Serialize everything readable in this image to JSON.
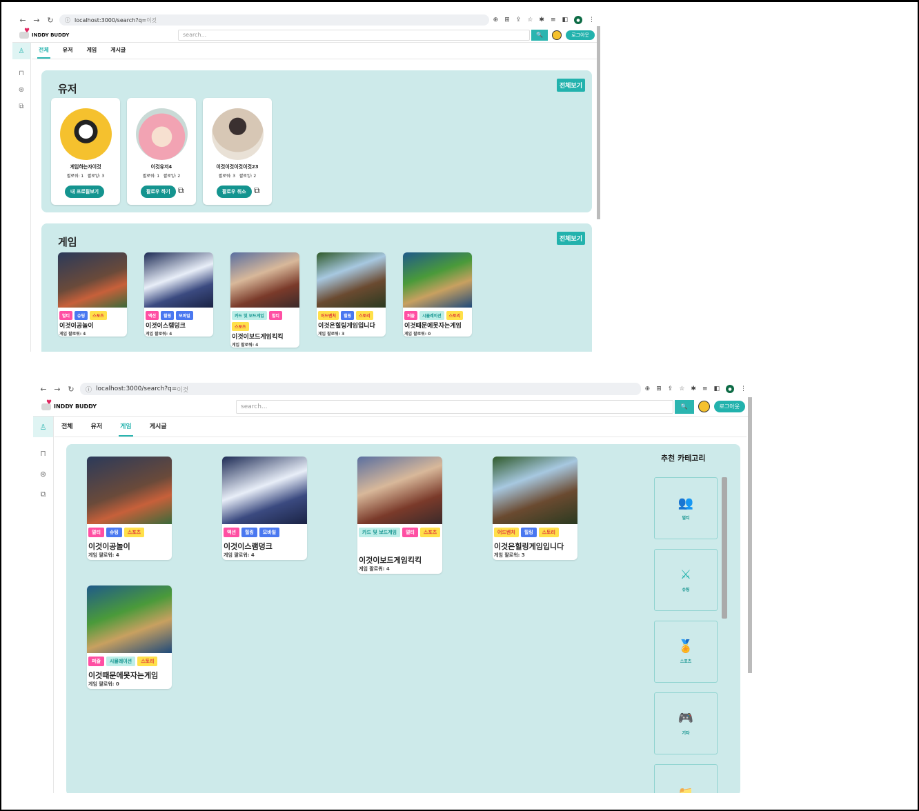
{
  "browser": {
    "url_host": "localhost:3000/search?q=",
    "url_query": "이것"
  },
  "app": {
    "brand": "INDDY BUDDY",
    "search_placeholder": "search...",
    "search_button": "🔍",
    "logout": "로그아웃"
  },
  "tabs": [
    "전체",
    "유저",
    "게임",
    "게시글"
  ],
  "view1": {
    "users_title": "유저",
    "users_all": "전체보기",
    "users": [
      {
        "name": "게임하는자이것",
        "followers": "팔로워: 1",
        "following": "팔로잉: 3",
        "button": "내 프로필보기",
        "chat": false
      },
      {
        "name": "이것유저4",
        "followers": "팔로워: 1",
        "following": "팔로잉: 2",
        "button": "팔로우 하기",
        "chat": true
      },
      {
        "name": "이것이것이것이것23",
        "followers": "팔로워: 3",
        "following": "팔로잉: 2",
        "button": "팔로우 취소",
        "chat": true
      }
    ],
    "games_title": "게임",
    "games_all": "전체보기"
  },
  "games": [
    {
      "name": "이것이공놀이",
      "followers": "게임 팔로워: 4",
      "tags": [
        {
          "t": "멀티",
          "c": "t-pink"
        },
        {
          "t": "슈팅",
          "c": "t-blue"
        },
        {
          "t": "스포츠",
          "c": "t-yel"
        }
      ]
    },
    {
      "name": "이것이스램덩크",
      "followers": "게임 팔로워: 4",
      "tags": [
        {
          "t": "액션",
          "c": "t-pink"
        },
        {
          "t": "힐링",
          "c": "t-blue"
        },
        {
          "t": "모바일",
          "c": "t-blue"
        }
      ]
    },
    {
      "name": "이것이보드게임킥킥",
      "followers": "게임 팔로워: 4",
      "tags": [
        {
          "t": "카드 및 보드게임",
          "c": "t-mint"
        },
        {
          "t": "멀티",
          "c": "t-pink"
        },
        {
          "t": "스포츠",
          "c": "t-yel"
        }
      ]
    },
    {
      "name": "이것은힐링게임입니다",
      "followers": "게임 팔로워: 3",
      "tags": [
        {
          "t": "어드벤처",
          "c": "t-yel"
        },
        {
          "t": "힐링",
          "c": "t-blue"
        },
        {
          "t": "스토리",
          "c": "t-yel"
        }
      ]
    },
    {
      "name": "이것때문에못자는게임",
      "followers": "게임 팔로워: 0",
      "tags": [
        {
          "t": "퍼즐",
          "c": "t-pink"
        },
        {
          "t": "시뮬레이션",
          "c": "t-mint"
        },
        {
          "t": "스토리",
          "c": "t-yel"
        }
      ]
    }
  ],
  "view2": {
    "category_title": "추천 카테고리",
    "categories": [
      {
        "label": "멀티",
        "icon": "multi-users-icon",
        "glyph": "👥"
      },
      {
        "label": "슈팅",
        "icon": "rifle-icon",
        "glyph": "⚔"
      },
      {
        "label": "스포츠",
        "icon": "medal-icon",
        "glyph": "🏅"
      },
      {
        "label": "기타",
        "icon": "gamepad-icon",
        "glyph": "🎮"
      },
      {
        "label": "",
        "icon": "folder-icon",
        "glyph": "📁"
      }
    ]
  },
  "colors": {
    "accent": "#22b2ad",
    "panel": "#cdeaea"
  }
}
